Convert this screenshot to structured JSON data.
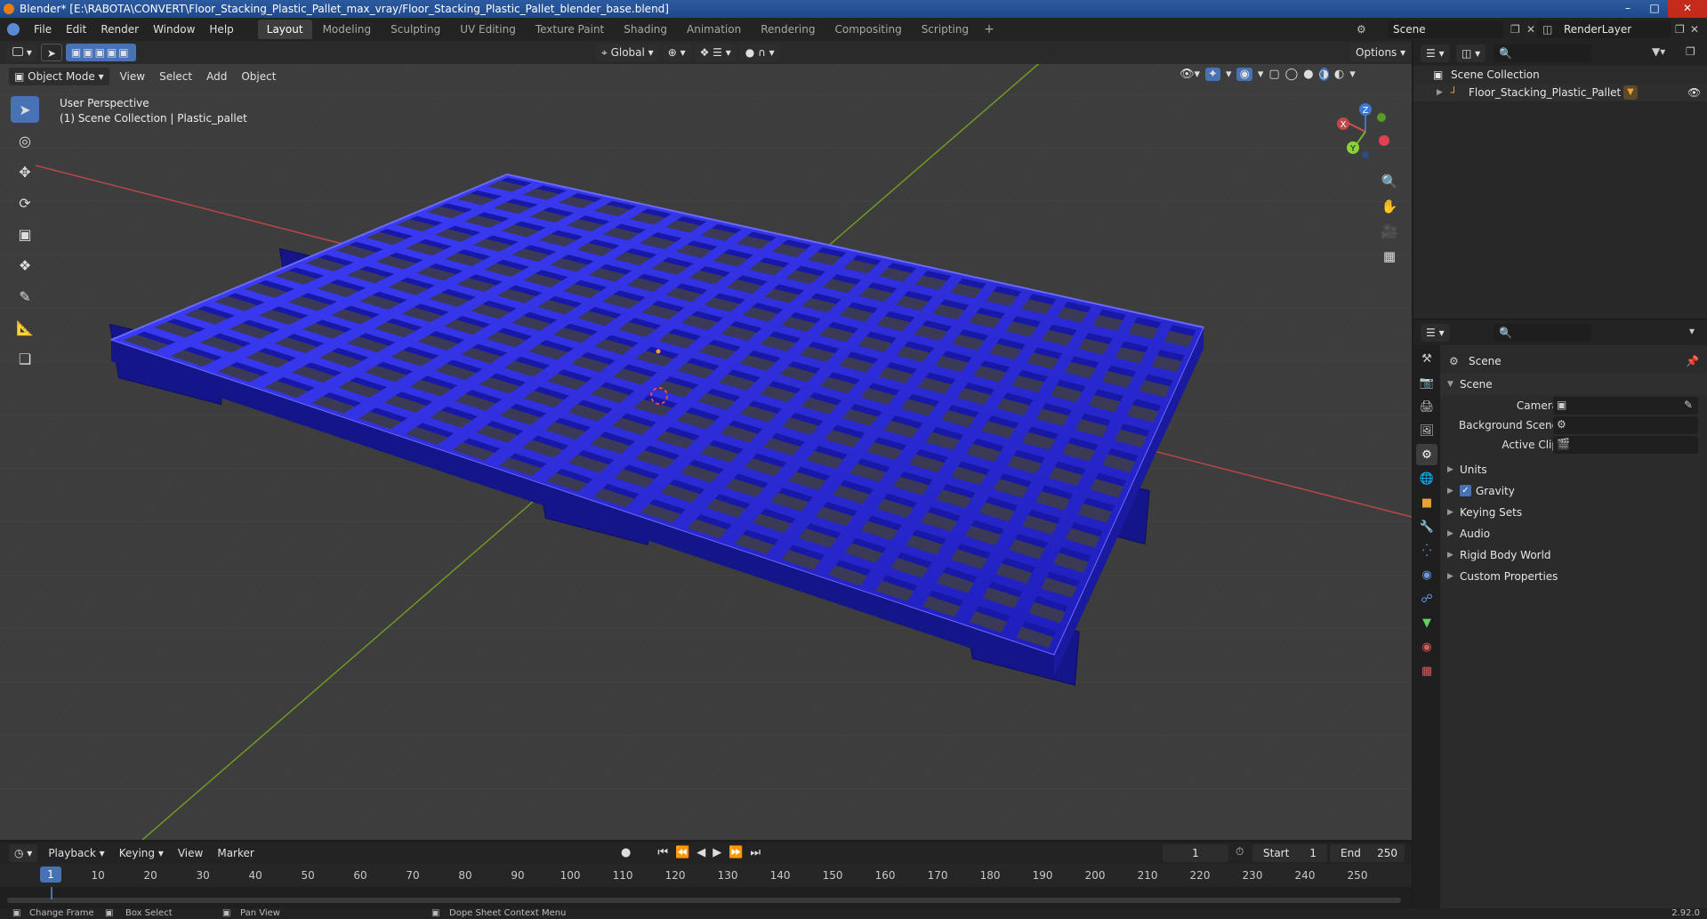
{
  "window": {
    "title": "Blender* [E:\\RABOTA\\CONVERT\\Floor_Stacking_Plastic_Pallet_max_vray/Floor_Stacking_Plastic_Pallet_blender_base.blend]"
  },
  "menu": [
    "File",
    "Edit",
    "Render",
    "Window",
    "Help"
  ],
  "workspaces": {
    "tabs": [
      "Layout",
      "Modeling",
      "Sculpting",
      "UV Editing",
      "Texture Paint",
      "Shading",
      "Animation",
      "Rendering",
      "Compositing",
      "Scripting"
    ],
    "active": "Layout",
    "add_symbol": "+"
  },
  "scene_selector": {
    "value": "Scene"
  },
  "renderlayer_selector": {
    "value": "RenderLayer"
  },
  "viewport": {
    "transform_orientation": "Global",
    "options_label": "Options",
    "mode": "Object Mode",
    "header_menus": [
      "View",
      "Select",
      "Add",
      "Object"
    ],
    "overlay_text_1": "User Perspective",
    "overlay_text_2": "(1) Scene Collection | Plastic_pallet",
    "gizmo_axes": {
      "x": "X",
      "y": "Y",
      "z": "Z"
    },
    "colors": {
      "background": "#3d3d3d",
      "grid": "#4a4a4a",
      "x_axis": "#c84a4a",
      "y_axis": "#7fa52a",
      "pallet": "#2a2ad8",
      "pallet_dark": "#15158a",
      "pallet_light": "#6a6aff"
    }
  },
  "timeline": {
    "menus": [
      "Playback",
      "Keying",
      "View",
      "Marker"
    ],
    "current_frame": "1",
    "start_label": "Start",
    "start_value": "1",
    "end_label": "End",
    "end_value": "250",
    "ruler": [
      "1",
      "10",
      "20",
      "30",
      "40",
      "50",
      "60",
      "70",
      "80",
      "90",
      "100",
      "110",
      "120",
      "130",
      "140",
      "150",
      "160",
      "170",
      "180",
      "190",
      "200",
      "210",
      "220",
      "230",
      "240",
      "250"
    ]
  },
  "statusbar": {
    "items": [
      "Change Frame",
      "Box Select",
      "Pan View",
      "Dope Sheet Context Menu"
    ],
    "version": "2.92.0"
  },
  "outliner": {
    "root": "Scene Collection",
    "items": [
      {
        "label": "Floor_Stacking_Plastic_Pallet"
      }
    ]
  },
  "properties": {
    "breadcrumb": "Scene",
    "panel_title": "Scene",
    "fields": [
      {
        "label": "Camera",
        "value": ""
      },
      {
        "label": "Background Scene",
        "value": ""
      },
      {
        "label": "Active Clip",
        "value": ""
      }
    ],
    "subpanels": [
      "Units",
      "Gravity",
      "Keying Sets",
      "Audio",
      "Rigid Body World",
      "Custom Properties"
    ],
    "gravity_checked": true
  }
}
